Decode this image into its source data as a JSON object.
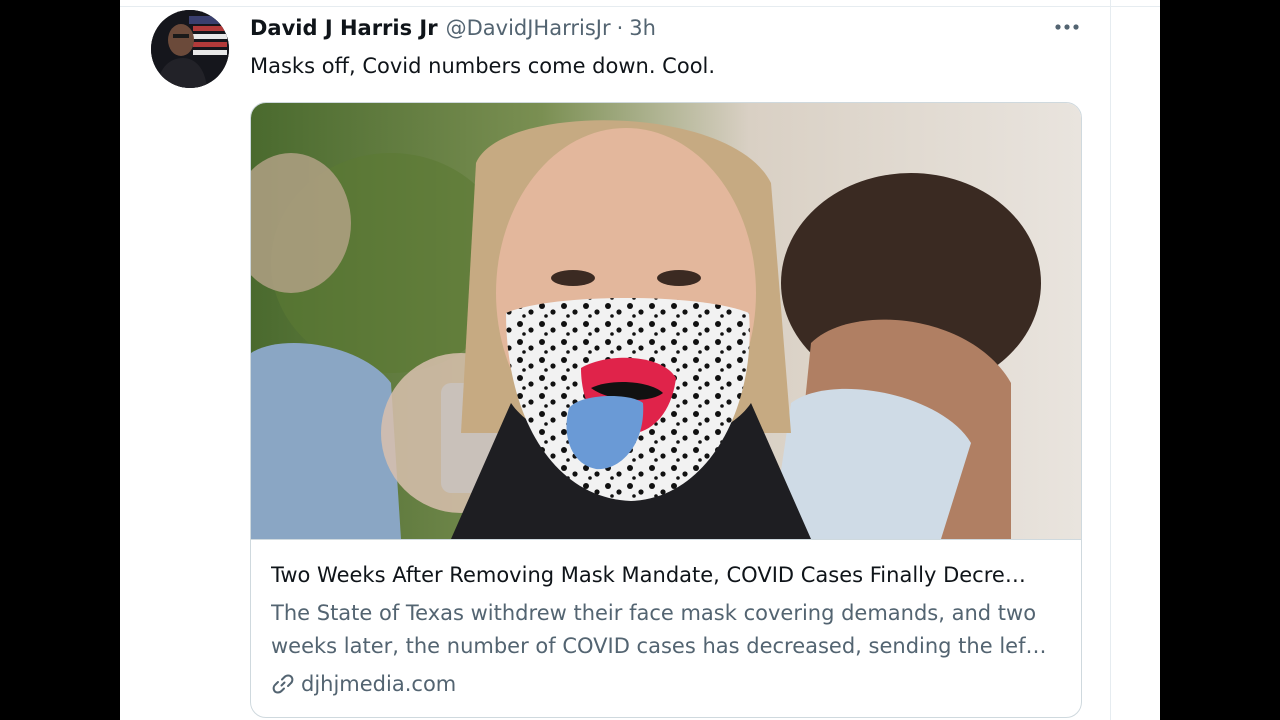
{
  "tweet": {
    "author": {
      "display_name": "David J Harris Jr",
      "handle": "@DavidJHarrisJr",
      "separator": "·",
      "time": "3h"
    },
    "text": "Masks off, Covid numbers come down. Cool.",
    "more_icon": "more-horizontal-icon",
    "card": {
      "title": "Two Weeks After Removing Mask Mandate, COVID Cases Finally Decre…",
      "description_lines": [
        "The State of Texas withdrew their face mask covering demands, and two",
        "weeks later, the number of COVID cases has decreased, sending the lef…"
      ],
      "domain": "djhjmedia.com",
      "domain_icon": "link-icon"
    }
  },
  "colors": {
    "text_primary": "#0f1419",
    "text_secondary": "#536471",
    "border": "#cfd9de",
    "background": "#ffffff",
    "letterbox": "#000000"
  }
}
